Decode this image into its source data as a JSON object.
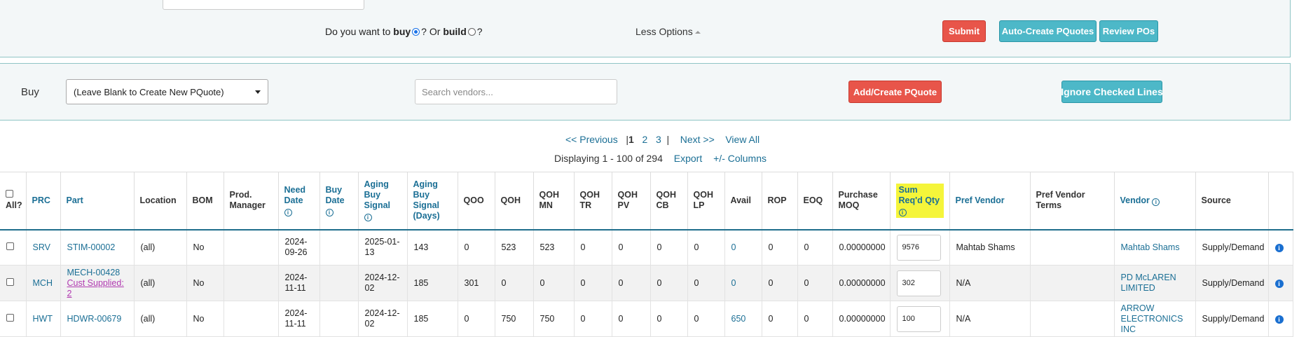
{
  "top_panel": {
    "question_prefix": "Do you want to",
    "buy_word": "buy",
    "q1": "?",
    "or_word": "Or",
    "build_word": "build",
    "q2": "?",
    "less_options": "Less Options",
    "submit": "Submit",
    "auto_create": "Auto-Create PQuotes",
    "review_pos": "Review POs"
  },
  "buy_panel": {
    "label": "Buy",
    "select_value": "(Leave Blank to Create New PQuote)",
    "search_placeholder": "Search vendors...",
    "add_create": "Add/Create PQuote",
    "ignore_checked": "Ignore Checked Lines"
  },
  "pagination": {
    "previous": "<< Previous",
    "sep": "|",
    "pages": [
      "1",
      "2",
      "3"
    ],
    "next": "Next >>",
    "view_all": "View All",
    "displaying": "Displaying 1 - 100 of 294",
    "export": "Export",
    "columns": "+/- Columns"
  },
  "table": {
    "headers": {
      "all": "All?",
      "prc": "PRC",
      "part": "Part",
      "location": "Location",
      "bom": "BOM",
      "prod_manager": "Prod. Manager",
      "need_date": "Need Date",
      "buy_date": "Buy Date",
      "aging_signal": "Aging Buy Signal",
      "aging_days": "Aging Buy Signal (Days)",
      "qoo": "QOO",
      "qoh": "QOH",
      "qoh_mn": "QOH MN",
      "qoh_tr": "QOH TR",
      "qoh_pv": "QOH PV",
      "qoh_cb": "QOH CB",
      "qoh_lp": "QOH LP",
      "avail": "Avail",
      "rop": "ROP",
      "eoq": "EOQ",
      "purchase_moq": "Purchase MOQ",
      "sum_reqd": "Sum Req'd Qty",
      "pref_vendor": "Pref Vendor",
      "pref_vendor_terms": "Pref Vendor Terms",
      "vendor": "Vendor",
      "source": "Source"
    },
    "rows": [
      {
        "prc": "SRV",
        "part": "STIM-00002",
        "sub": "",
        "location": "(all)",
        "bom": "No",
        "need_date": "2024-09-26",
        "buy_date": "",
        "aging_signal": "2025-01-13",
        "aging_days": "143",
        "qoo": "0",
        "qoh": "523",
        "qoh_mn": "523",
        "qoh_tr": "0",
        "qoh_pv": "0",
        "qoh_cb": "0",
        "qoh_lp": "0",
        "avail": "0",
        "rop": "0",
        "eoq": "0",
        "moq": "0.00000000",
        "sum_qty": "9576",
        "pref_vendor": "Mahtab Shams",
        "vendor": "Mahtab Shams",
        "source": "Supply/Demand"
      },
      {
        "prc": "MCH",
        "part": "MECH-00428",
        "sub": "Cust Supplied: 2",
        "location": "(all)",
        "bom": "No",
        "need_date": "2024-11-11",
        "buy_date": "",
        "aging_signal": "2024-12-02",
        "aging_days": "185",
        "qoo": "301",
        "qoh": "0",
        "qoh_mn": "0",
        "qoh_tr": "0",
        "qoh_pv": "0",
        "qoh_cb": "0",
        "qoh_lp": "0",
        "avail": "0",
        "rop": "0",
        "eoq": "0",
        "moq": "0.00000000",
        "sum_qty": "302",
        "pref_vendor": "N/A",
        "vendor": "PD McLAREN LIMITED",
        "source": "Supply/Demand"
      },
      {
        "prc": "HWT",
        "part": "HDWR-00679",
        "sub": "",
        "location": "(all)",
        "bom": "No",
        "need_date": "2024-11-11",
        "buy_date": "",
        "aging_signal": "2024-12-02",
        "aging_days": "185",
        "qoo": "0",
        "qoh": "750",
        "qoh_mn": "750",
        "qoh_tr": "0",
        "qoh_pv": "0",
        "qoh_cb": "0",
        "qoh_lp": "0",
        "avail": "650",
        "rop": "0",
        "eoq": "0",
        "moq": "0.00000000",
        "sum_qty": "100",
        "pref_vendor": "N/A",
        "vendor": "ARROW ELECTRONICS INC",
        "source": "Supply/Demand"
      }
    ]
  },
  "colors": {
    "red_button": "#e8554a",
    "teal_button": "#4db8c8",
    "link": "#1b6f95",
    "highlight": "#f5f53a"
  }
}
